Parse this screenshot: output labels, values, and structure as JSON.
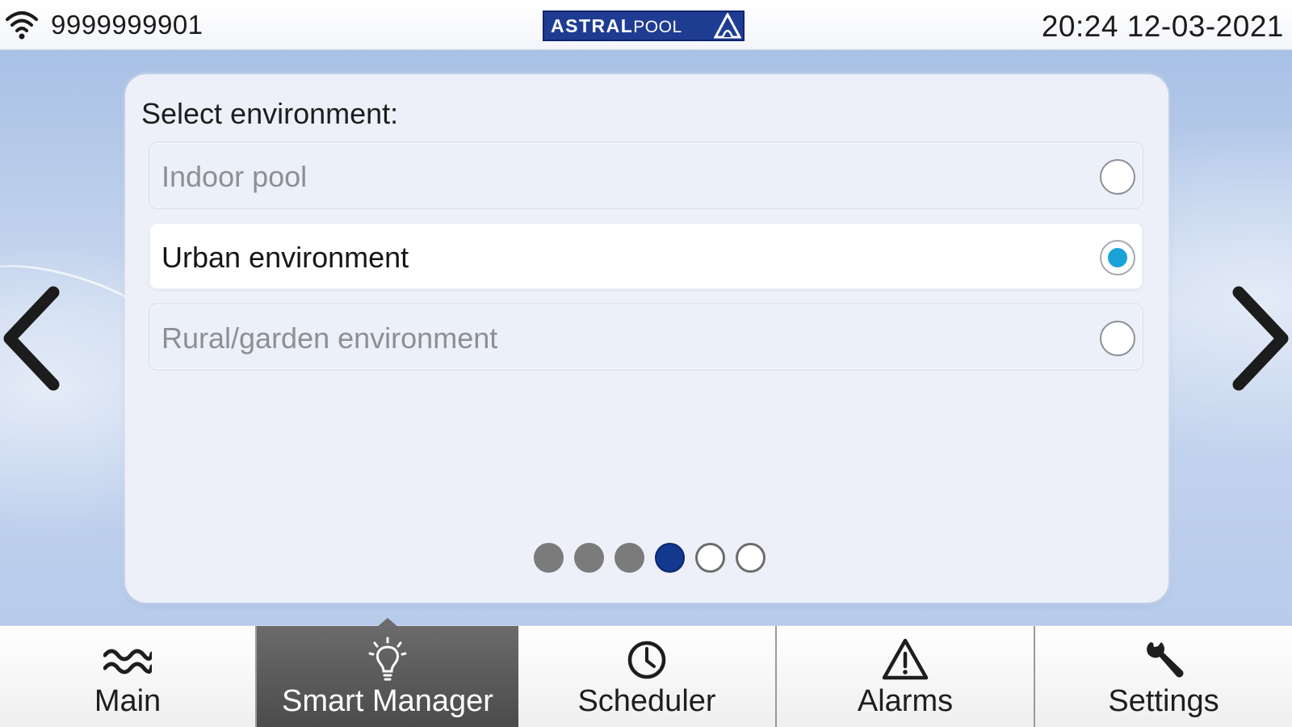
{
  "status_bar": {
    "phone_number": "9999999901",
    "datetime": "20:24 12-03-2021",
    "wifi_icon": "wifi-icon",
    "logo": {
      "bold": "ASTRAL",
      "light": "POOL",
      "mark_icon": "astralpool-triangle-icon",
      "background": "#1f3c93"
    }
  },
  "panel": {
    "title": "Select environment:",
    "options": [
      {
        "label": "Indoor pool",
        "selected": false
      },
      {
        "label": "Urban environment",
        "selected": true
      },
      {
        "label": "Rural/garden environment",
        "selected": false
      }
    ],
    "pagination": {
      "total": 6,
      "current": 4,
      "states": [
        "done",
        "done",
        "done",
        "active",
        "todo",
        "todo"
      ]
    }
  },
  "navigation": {
    "prev_icon": "chevron-left-icon",
    "next_icon": "chevron-right-icon"
  },
  "tabs": [
    {
      "label": "Main",
      "icon": "waves-icon",
      "active": false
    },
    {
      "label": "Smart Manager",
      "icon": "lightbulb-icon",
      "active": true
    },
    {
      "label": "Scheduler",
      "icon": "clock-icon",
      "active": false
    },
    {
      "label": "Alarms",
      "icon": "warning-icon",
      "active": false
    },
    {
      "label": "Settings",
      "icon": "wrench-icon",
      "active": false
    }
  ],
  "colors": {
    "accent": "#1aa3d9",
    "active_dot": "#13398f",
    "active_tab": "#5a5a5a"
  }
}
